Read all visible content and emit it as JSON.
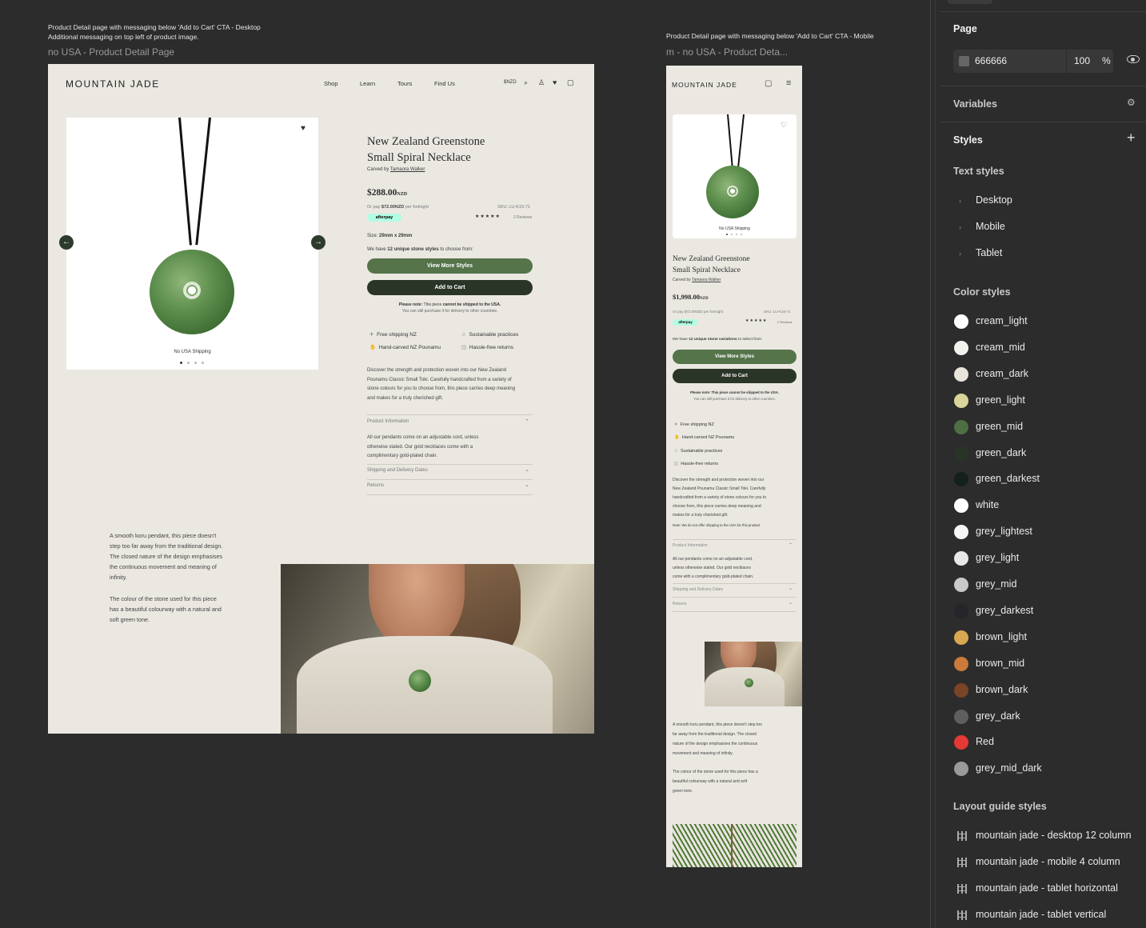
{
  "canvas": {
    "desktop_note_line1": "Product Detail page with messaging below 'Add to Cart' CTA - Desktop",
    "desktop_note_line2": "Additional messaging on top left of product image.",
    "desktop_frame_name": "no USA - Product Detail Page",
    "mobile_note": "Product Detail page with messaging below 'Add to Cart' CTA - Mobile",
    "mobile_frame_name": "m - no USA - Product Deta..."
  },
  "desktop": {
    "logo": "MOUNTAIN JADE",
    "nav": [
      "Shop",
      "Learn",
      "Tours",
      "Find Us"
    ],
    "currency": "$NZD",
    "image_caption": "No USA Shipping",
    "title_line1": "New Zealand Greenstone",
    "title_line2": "Small Spiral Necklace",
    "carved_by_prefix": "Carved by ",
    "carver": "Tamaora Walker",
    "price": "$288.00",
    "price_unit": "NZD",
    "afterpay_text_prefix": "Or pay ",
    "afterpay_amount": "$72.00NZD",
    "afterpay_text_suffix": " per fortnight",
    "afterpay_badge": "afterpay",
    "sku": "SKU: LU-K15-71",
    "stars": "★★★★★",
    "reviews": "2 Reviews",
    "size_label": "Size: ",
    "size_value": "29mm x 29mm",
    "styles_prefix": "We have ",
    "styles_bold": "12 unique stone styles",
    "styles_suffix": " to choose from:",
    "view_more": "View More Styles",
    "add_to_cart": "Add to Cart",
    "note_bold": "Please note:",
    "note_text": " This piece ",
    "note_bold2": "cannot be shipped to the USA.",
    "note_line2": "You can still purchase it for delivery to other countries.",
    "features": [
      "Free shipping NZ",
      "Sustainable practices",
      "Hand-carved NZ Pounamu",
      "Hassle-free returns"
    ],
    "description": [
      "Discover the strength and protection woven into our New Zealand",
      "Pounamu Classic Small Toki. Carefully handcrafted from a variety of",
      "stone colours for you to choose from, this piece carries deep meaning",
      "and makes for a truly cherished gift."
    ],
    "accordion": [
      {
        "label": "Product Information",
        "body": [
          "All our pendants come on an adjustable cord, unless",
          "otherwise stated. Our gold necklaces come with a",
          "complimentary gold-plated chain."
        ]
      },
      {
        "label": "Shipping and Delivery Dates"
      },
      {
        "label": "Returns"
      }
    ],
    "story_p1": [
      "A smooth koru pendant, this piece doesn't",
      "step too far away from the traditional design.",
      "The closed nature of the design emphasises",
      "the continuous movement and meaning of",
      "infinity."
    ],
    "story_p2": [
      "The colour of the stone used for this piece",
      "has a beautiful colourway with a natural and",
      "soft green tone."
    ]
  },
  "mobile": {
    "logo": "MOUNTAIN JADE",
    "image_caption": "No USA Shipping",
    "title_line1": "New Zealand Greenstone",
    "title_line2": "Small Spiral Necklace",
    "carved_by_prefix": "Carved by ",
    "carver": "Tamaora Walker",
    "price": "$1,998.00",
    "price_unit": "NZD",
    "afterpay_text": "Or pay $72.00NZD per fortnight",
    "afterpay_badge": "afterpay",
    "sku": "SKU: LU-K15-71",
    "stars": "★★★★★",
    "reviews": "2 Reviews",
    "styles_prefix": "We have ",
    "styles_bold": "12 unique stone variations",
    "styles_suffix": " to select from:",
    "view_more": "View More Styles",
    "add_to_cart": "Add to Cart",
    "note_line1": "Please note: This piece cannot be shipped to the USA.",
    "note_line2": "You can still purchase it for delivery to other countries.",
    "features": [
      "Free shipping NZ",
      "Hand-carved NZ Pounamu",
      "Sustainable practices",
      "Hassle-free returns"
    ],
    "description": [
      "Discover the strength and protection woven into our",
      "New Zealand Pounamu Classic Small Toki. Carefully",
      "handcrafted from a variety of stone colours for you to",
      "choose from, this piece carries deep meaning and",
      "makes for a truly cherished gift."
    ],
    "shipping_note": "Note: We do not offer shipping to the USA for this product.",
    "accordion": [
      {
        "label": "Product Information",
        "body": [
          "All our pendants come on an adjustable cord,",
          "unless otherwise stated. Our gold necklaces",
          "come with a complimentary gold-plated chain."
        ]
      },
      {
        "label": "Shipping and Delivery Dates"
      },
      {
        "label": "Returns"
      }
    ],
    "story_p1": [
      "A smooth koru pendant, this piece doesn't step too",
      "far away from the traditional design. The closed",
      "nature of the design emphasises the continuous",
      "movement and meaning of infinity."
    ],
    "story_p2": [
      "The colour of the stone used for this piece has a",
      "beautiful colourway with a natural and soft",
      "green tone."
    ]
  },
  "panel": {
    "page_title": "Page",
    "page_fill_hex": "666666",
    "page_fill_color": "#666666",
    "page_opacity": "100",
    "page_opacity_unit": "%",
    "variables_label": "Variables",
    "styles_label": "Styles",
    "text_styles_label": "Text styles",
    "text_styles": [
      "Desktop",
      "Mobile",
      "Tablet"
    ],
    "color_styles_label": "Color styles",
    "color_styles": [
      {
        "name": "cream_light",
        "color": "#ffffff"
      },
      {
        "name": "cream_mid",
        "color": "#f4f2ee"
      },
      {
        "name": "cream_dark",
        "color": "#e8e4da"
      },
      {
        "name": "green_light",
        "color": "#d9d59a"
      },
      {
        "name": "green_mid",
        "color": "#4e6e44"
      },
      {
        "name": "green_dark",
        "color": "#283526"
      },
      {
        "name": "green_darkest",
        "color": "#14201a"
      },
      {
        "name": "white",
        "color": "#ffffff"
      },
      {
        "name": "grey_lightest",
        "color": "#f6f6f6"
      },
      {
        "name": "grey_light",
        "color": "#e8e8e8"
      },
      {
        "name": "grey_mid",
        "color": "#c9c9c9"
      },
      {
        "name": "grey_darkest",
        "color": "#25262b"
      },
      {
        "name": "brown_light",
        "color": "#d9a652"
      },
      {
        "name": "brown_mid",
        "color": "#c97a3c"
      },
      {
        "name": "brown_dark",
        "color": "#7a4426"
      },
      {
        "name": "grey_dark",
        "color": "#5e5e5e"
      },
      {
        "name": "Red",
        "color": "#e53935"
      },
      {
        "name": "grey_mid_dark",
        "color": "#9a9a9a"
      }
    ],
    "layout_guides_label": "Layout guide styles",
    "layout_guides": [
      "mountain jade - desktop 12 column",
      "mountain jade - mobile 4 column",
      "mountain jade - tablet horizontal",
      "mountain jade - tablet vertical"
    ]
  }
}
